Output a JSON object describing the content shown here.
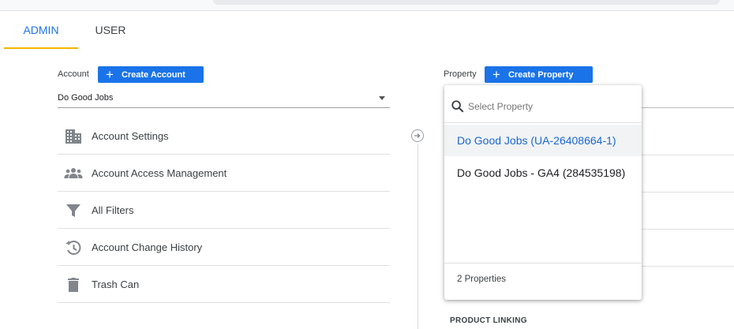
{
  "tabs": [
    {
      "label": "ADMIN"
    },
    {
      "label": "USER"
    }
  ],
  "account": {
    "label": "Account",
    "create_button": "Create Account",
    "selected": "Do Good Jobs",
    "menu": [
      {
        "label": "Account Settings",
        "icon": "building-icon"
      },
      {
        "label": "Account Access Management",
        "icon": "people-icon"
      },
      {
        "label": "All Filters",
        "icon": "filter-icon"
      },
      {
        "label": "Account Change History",
        "icon": "history-icon"
      },
      {
        "label": "Trash Can",
        "icon": "trash-icon"
      }
    ]
  },
  "property": {
    "label": "Property",
    "create_button": "Create Property",
    "dropdown": {
      "search_placeholder": "Select Property",
      "options": [
        {
          "label": "Do Good Jobs (UA-26408664-1)",
          "selected": true
        },
        {
          "label": "Do Good Jobs - GA4 (284535198)",
          "selected": false
        }
      ],
      "footer": "2 Properties"
    }
  },
  "section_heading": "PRODUCT LINKING",
  "colors": {
    "accent": "#1a73e8",
    "tab_indicator": "#f4b400",
    "selected_option_text": "#1967d2"
  }
}
